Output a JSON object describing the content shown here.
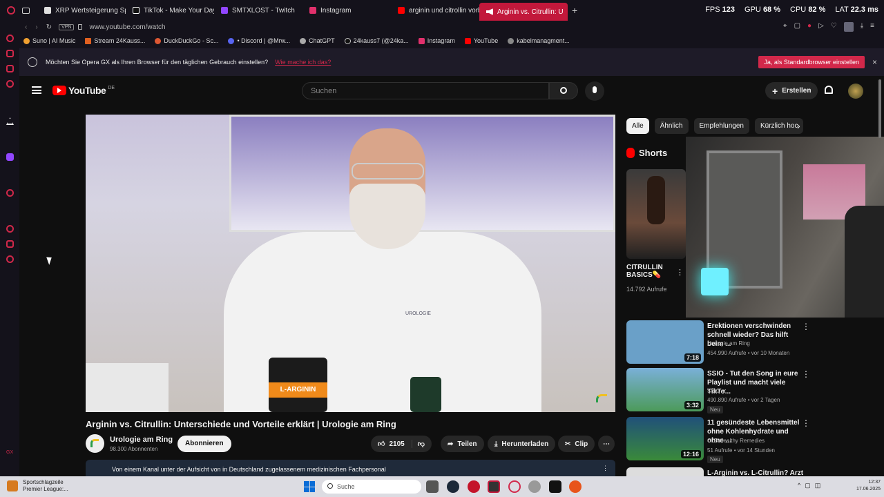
{
  "tabs": [
    {
      "label": "XRP Wertsteigerung Spe",
      "color": "#e0e0e0"
    },
    {
      "label": "TikTok - Make Your Day",
      "color": "#111"
    },
    {
      "label": "SMTXLOST - Twitch",
      "color": "#9146ff"
    },
    {
      "label": "Instagram",
      "color": "#e1306c"
    },
    {
      "label": "arginin und citrollin vorbe",
      "color": "#ff0000"
    },
    {
      "label": "Arginin vs. Citrullin: U",
      "color": "#fff"
    }
  ],
  "stats": {
    "fps_label": "FPS",
    "fps": "123",
    "gpu_label": "GPU",
    "gpu": "68 %",
    "cpu_label": "CPU",
    "cpu": "82 %",
    "lat_label": "LAT",
    "lat": "22.3 ms"
  },
  "address": {
    "vpn": "VPN",
    "url": "www.youtube.com/watch"
  },
  "bookmarks": [
    {
      "label": "Suno | AI Music",
      "color": "#f0a030"
    },
    {
      "label": "Stream 24Kauss...",
      "color": "#e06020"
    },
    {
      "label": "DuckDuckGo - Sc...",
      "color": "#de5833"
    },
    {
      "label": "• Discord | @Mrw...",
      "color": "#5865f2"
    },
    {
      "label": "ChatGPT",
      "color": "#aaa"
    },
    {
      "label": "24kauss7 (@24ka...",
      "color": "#111"
    },
    {
      "label": "Instagram",
      "color": "#e1306c"
    },
    {
      "label": "YouTube",
      "color": "#ff0000"
    },
    {
      "label": "kabelmanagment...",
      "color": "#888"
    }
  ],
  "banner": {
    "text": "Möchten Sie Opera GX als Ihren Browser für den täglichen Gebrauch einstellen?",
    "link": "Wie mache ich das?",
    "button": "Ja, als Standardbrowser einstellen"
  },
  "header": {
    "logo": "YouTube",
    "country": "DE",
    "search_placeholder": "Suchen",
    "create": "Erstellen"
  },
  "video": {
    "title": "Arginin vs. Citrullin: Unterschiede und Vorteile erklärt | Urologie am Ring",
    "channel": "Urologie am Ring",
    "subs": "98.300 Abonnenten",
    "subscribe": "Abonnieren",
    "likes": "2105",
    "share": "Teilen",
    "download": "Herunterladen",
    "clip": "Clip",
    "notice": "Von einem Kanal unter der Aufsicht von in Deutschland zugelassenem medizinischen Fachpersonal",
    "jar1_label": "L-ARGININ",
    "jar2_label": "UROLOGIE"
  },
  "chips": [
    "Alle",
    "Ähnlich",
    "Empfehlungen",
    "Kürzlich hoc"
  ],
  "shorts": {
    "heading": "Shorts",
    "title": "CITRULLIN BASICS💊",
    "views": "14.792 Aufrufe"
  },
  "related": [
    {
      "title": "Erektionen verschwinden schnell wieder? Das hilft beim ...",
      "channel": "Urologie am Ring",
      "meta": "454.990 Aufrufe • vor 10 Monaten",
      "dur": "7:18",
      "badge": "",
      "bg": "#6aa0c8"
    },
    {
      "title": "SSIO - Tut den Song in eure Playlist und macht viele TikTo...",
      "channel": "SSIO ✔",
      "meta": "490.890 Aufrufe • vor 2 Tagen",
      "dur": "3:32",
      "badge": "Neu",
      "bg": "#4c9a5a"
    },
    {
      "title": "11 gesündeste Lebensmittel ohne Kohlenhydrate und ohne ...",
      "channel": "CLB Healthy Remedies",
      "meta": "51 Aufrufe • vor 14 Stunden",
      "dur": "12:16",
      "badge": "Neu",
      "bg": "#20507a"
    },
    {
      "title": "L-Arginin vs. L-Citrullin? Arzt",
      "channel": "",
      "meta": "",
      "dur": "",
      "badge": "",
      "bg": "#ddd"
    }
  ],
  "taskbar": {
    "weather1": "Sportschlagzeile",
    "weather2": "Premier League:...",
    "search": "Suche",
    "time": "12:37",
    "date": "17.06.2025"
  }
}
